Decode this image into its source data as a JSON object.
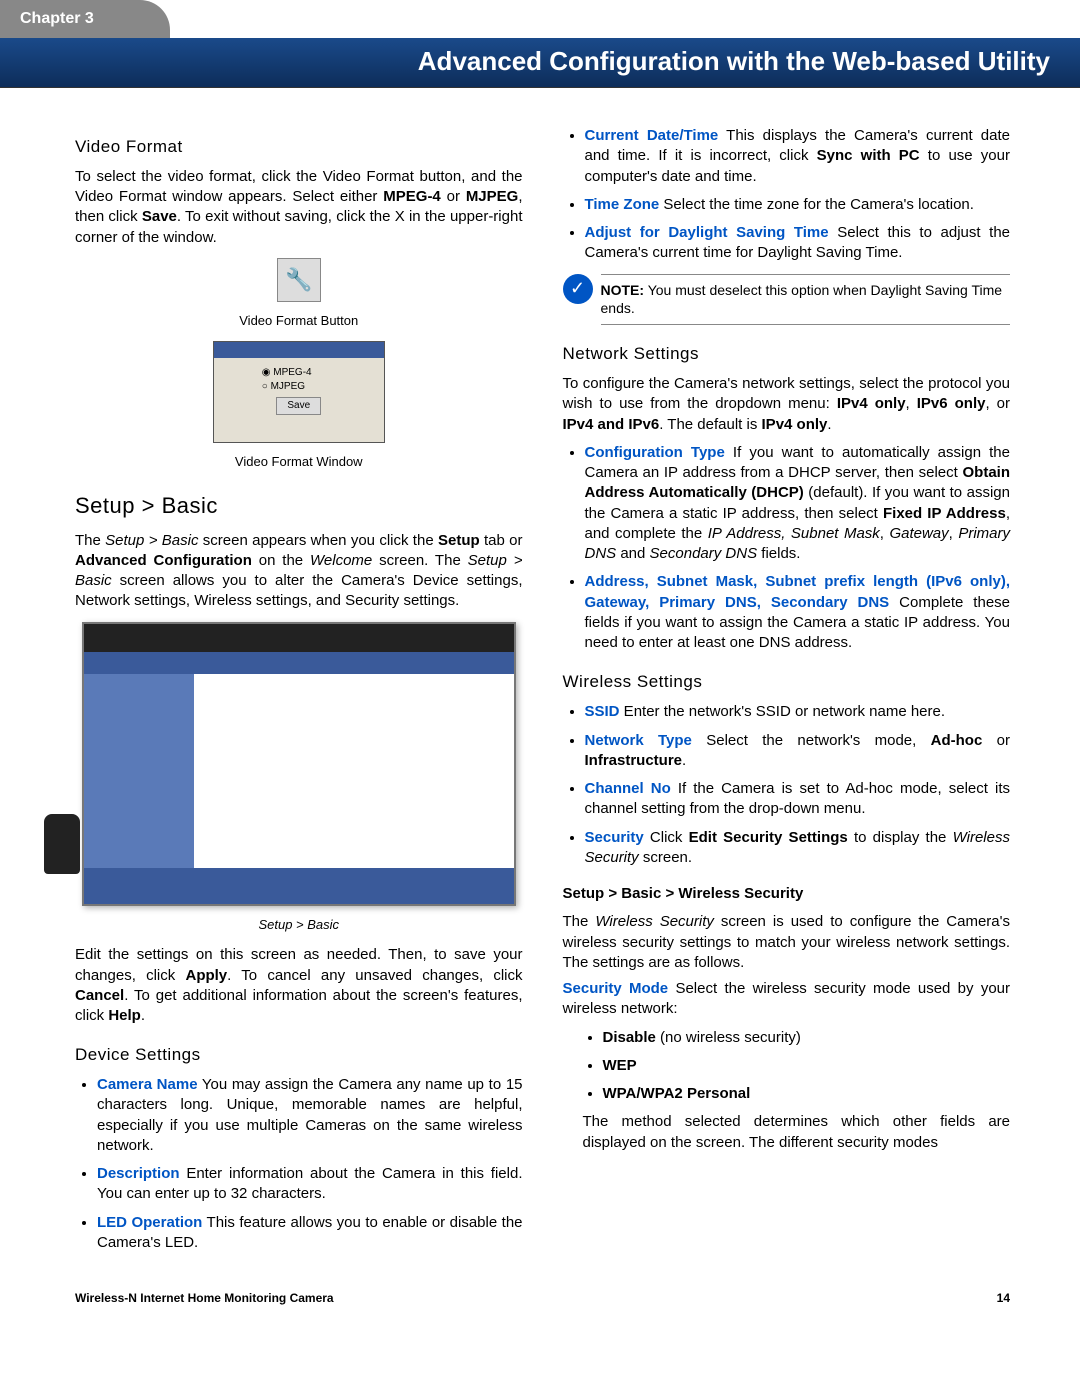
{
  "chapter": "Chapter 3",
  "header_title": "Advanced Configuration with the Web-based Utility",
  "left": {
    "video_format_heading": "Video Format",
    "video_format_text": "To select the video format, click the Video Format button, and the Video Format window appears. Select either MPEG-4 or MJPEG, then click Save. To exit without saving, click the X in the upper-right corner of the window.",
    "video_format_button_caption": "Video Format Button",
    "window_opt1": "MPEG-4",
    "window_opt2": "MJPEG",
    "window_save": "Save",
    "video_format_window_caption": "Video Format Window",
    "setup_basic_heading": "Setup > Basic",
    "setup_basic_text": "The Setup > Basic screen appears when you click the Setup tab or Advanced Configuration on the Welcome screen. The Setup > Basic screen allows you to alter the Camera's Device settings, Network settings, Wireless settings, and Security settings.",
    "setup_basic_caption": "Setup > Basic",
    "edit_text": "Edit the settings on this screen as needed. Then, to save your changes, click Apply. To cancel any unsaved changes, click Cancel. To get additional information about the screen's features, click Help.",
    "device_settings_heading": "Device Settings",
    "camera_name_label": "Camera Name",
    "camera_name_text": " You may assign the Camera any name up to 15 characters long. Unique, memorable names are helpful, especially if you use multiple Cameras on the same wireless network.",
    "description_label": "Description",
    "description_text": " Enter information about the Camera in this field. You can enter up to 32 characters.",
    "led_label": "LED Operation",
    "led_text": " This feature allows you to enable or disable the Camera's LED."
  },
  "right": {
    "current_date_label": "Current Date/Time",
    "current_date_text": " This displays the Camera's current date and time. If it is incorrect, click Sync with PC to use your computer's date and time.",
    "time_zone_label": "Time Zone",
    "time_zone_text": " Select the time zone for the Camera's location.",
    "dst_label": "Adjust for Daylight Saving Time",
    "dst_text": " Select this to adjust the Camera's current time for Daylight Saving Time.",
    "note_label": "NOTE:",
    "note_text": " You must deselect this option when Daylight Saving Time ends.",
    "network_heading": "Network Settings",
    "network_text": "To configure the Camera's network settings, select the protocol you wish to use from the dropdown menu: IPv4 only, IPv6 only, or IPv4 and IPv6. The default is IPv4 only.",
    "config_type_label": "Configuration Type",
    "config_type_text": " If you want to automatically assign the Camera an IP address from a DHCP server, then select Obtain Address Automatically (DHCP) (default). If you want to assign the Camera a static IP address, then select Fixed IP Address, and complete the IP Address, Subnet Mask, Gateway, Primary DNS and Secondary DNS fields.",
    "address_label": "Address, Subnet Mask, Subnet prefix length (IPv6 only), Gateway, Primary DNS, Secondary DNS",
    "address_text": " Complete these fields if you want to assign the Camera a static IP address. You need to enter at least one DNS address.",
    "wireless_heading": "Wireless Settings",
    "ssid_label": "SSID",
    "ssid_text": " Enter the network's SSID or network name here.",
    "nettype_label": "Network Type",
    "nettype_text": " Select the network's mode, Ad-hoc or Infrastructure.",
    "channel_label": "Channel No",
    "channel_text": " If the Camera is set to Ad-hoc mode, select its channel setting from the drop-down menu.",
    "security_label": "Security",
    "security_text": " Click Edit Security Settings to display the Wireless Security screen.",
    "wireless_security_heading": "Setup > Basic > Wireless Security",
    "wireless_security_text": "The Wireless Security screen is used to configure the Camera's wireless security settings to match your wireless network settings. The settings are as follows.",
    "secmode_label": "Security Mode",
    "secmode_text": " Select the wireless security mode used by your wireless network:",
    "disable": "Disable",
    "disable_text": " (no wireless security)",
    "wep": "WEP",
    "wpa": "WPA/WPA2 Personal",
    "method_text": "The method selected determines which other fields are displayed on the screen. The different security modes"
  },
  "footer_left": "Wireless-N Internet Home Monitoring Camera",
  "footer_right": "14"
}
